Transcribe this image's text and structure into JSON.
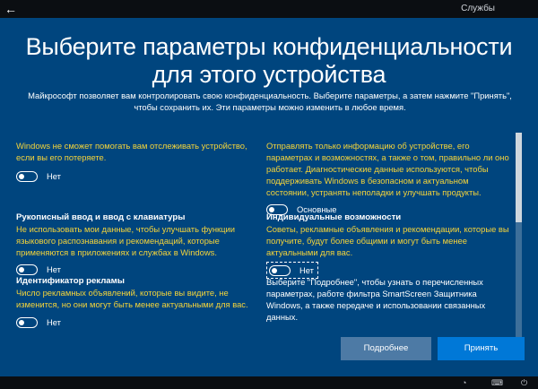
{
  "topbar": {
    "back_icon": "back-arrow-icon",
    "back_glyph": "←",
    "services_label": "Службы"
  },
  "title": "Выберите параметры конфиденциальности для этого устройства",
  "intro": "Майкрософт позволяет вам контролировать свою конфиденциальность. Выберите параметры, а затем нажмите \"Принять\", чтобы сохранить их. Эти параметры можно изменить в любое время.",
  "left": {
    "location": {
      "description": "Windows не сможет помогать вам отслеживать устройство, если вы его потеряете.",
      "toggle_label": "Нет"
    },
    "inking": {
      "heading": "Рукописный ввод и ввод с клавиатуры",
      "description": "Не использовать мои данные, чтобы улучшать функции языкового распознавания и рекомендаций, которые применяются в приложениях и службах в Windows.",
      "toggle_label": "Нет"
    },
    "advertising": {
      "heading": "Идентификатор рекламы",
      "description": "Число рекламных объявлений, которые вы видите, не изменится, но они могут быть менее актуальными для вас.",
      "toggle_label": "Нет"
    }
  },
  "right": {
    "diagnostics": {
      "description": "Отправлять только информацию об устройстве, его параметрах и возможностях, а также о том, правильно ли оно работает. Диагностические данные используются, чтобы поддерживать Windows в безопасном и актуальном состоянии, устранять неполадки и улучшать продукты.",
      "toggle_label": "Основные"
    },
    "tailored": {
      "heading": "Индивидуальные возможности",
      "description": "Советы, рекламные объявления и рекомендации, которые вы получите, будут более общими и могут быть менее актуальными для вас.",
      "toggle_label": "Нет"
    },
    "footer": "Выберите \"Подробнее\", чтобы узнать о перечисленных параметрах, работе фильтра SmartScreen Защитника Windows, а также передаче и использовании связанных данных."
  },
  "buttons": {
    "more_label": "Подробнее",
    "accept_label": "Принять"
  },
  "taskbar": {
    "icons": [
      "ease-of-access-icon",
      "keyboard-icon",
      "power-icon"
    ],
    "glyphs": [
      "◔",
      "⌨",
      "⏻"
    ]
  },
  "colors": {
    "background": "#00457e",
    "accent": "#0078d7",
    "highlight_text": "#f5d43a",
    "bar": "#0b0e12"
  }
}
